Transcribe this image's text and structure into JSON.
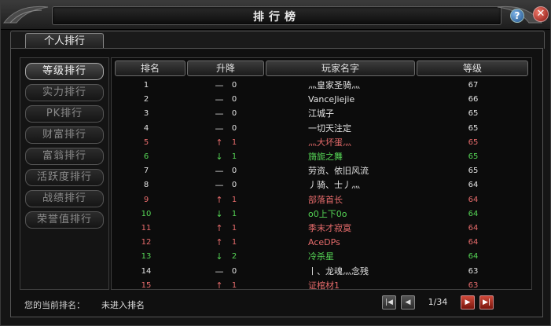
{
  "window": {
    "title": "排行榜"
  },
  "tabs": [
    {
      "label": "个人排行"
    }
  ],
  "sidebar": {
    "items": [
      {
        "label": "等级排行",
        "active": true
      },
      {
        "label": "实力排行",
        "active": false
      },
      {
        "label": "PK排行",
        "active": false
      },
      {
        "label": "财富排行",
        "active": false
      },
      {
        "label": "富翁排行",
        "active": false
      },
      {
        "label": "活跃度排行",
        "active": false
      },
      {
        "label": "战绩排行",
        "active": false
      },
      {
        "label": "荣誉值排行",
        "active": false
      }
    ]
  },
  "table": {
    "headers": {
      "rank": "排名",
      "change": "升降",
      "name": "玩家名字",
      "level": "等级"
    },
    "rows": [
      {
        "rank": "1",
        "arrow": "—",
        "change": "0",
        "name": "灬皇家圣骑灬",
        "level": "67",
        "color": "white"
      },
      {
        "rank": "2",
        "arrow": "—",
        "change": "0",
        "name": "VanceJiejie",
        "level": "66",
        "color": "white"
      },
      {
        "rank": "3",
        "arrow": "—",
        "change": "0",
        "name": "江城子",
        "level": "65",
        "color": "white"
      },
      {
        "rank": "4",
        "arrow": "—",
        "change": "0",
        "name": "一切天注定",
        "level": "65",
        "color": "white"
      },
      {
        "rank": "5",
        "arrow": "↑",
        "change": "1",
        "name": "灬大坏蛋灬",
        "level": "65",
        "color": "red"
      },
      {
        "rank": "6",
        "arrow": "↓",
        "change": "1",
        "name": "旖旎之舞",
        "level": "65",
        "color": "green"
      },
      {
        "rank": "7",
        "arrow": "—",
        "change": "0",
        "name": "劳资、依旧风流",
        "level": "65",
        "color": "white"
      },
      {
        "rank": "8",
        "arrow": "—",
        "change": "0",
        "name": "丿骑、士丿灬",
        "level": "64",
        "color": "white"
      },
      {
        "rank": "9",
        "arrow": "↑",
        "change": "1",
        "name": "部落首长",
        "level": "64",
        "color": "red"
      },
      {
        "rank": "10",
        "arrow": "↓",
        "change": "1",
        "name": "o0上下0o",
        "level": "64",
        "color": "green"
      },
      {
        "rank": "11",
        "arrow": "↑",
        "change": "1",
        "name": "季末才寂寞",
        "level": "64",
        "color": "red"
      },
      {
        "rank": "12",
        "arrow": "↑",
        "change": "1",
        "name": "AceDPs",
        "level": "64",
        "color": "red"
      },
      {
        "rank": "13",
        "arrow": "↓",
        "change": "2",
        "name": "冷杀星",
        "level": "64",
        "color": "green"
      },
      {
        "rank": "14",
        "arrow": "—",
        "change": "0",
        "name": "丨、龙魂灬念残",
        "level": "63",
        "color": "white"
      },
      {
        "rank": "15",
        "arrow": "↑",
        "change": "1",
        "name": "证棺材1",
        "level": "63",
        "color": "red"
      }
    ]
  },
  "footer": {
    "label": "您的当前排名：",
    "value": "未进入排名"
  },
  "pagination": {
    "page": "1/34"
  },
  "colors": {
    "up": "#e66b6b",
    "down": "#55d455",
    "same": "#e2e2e2"
  },
  "icons": {
    "help": "?",
    "close": "✕",
    "first": "|◀",
    "prev": "◀",
    "next": "▶",
    "last": "▶|"
  }
}
